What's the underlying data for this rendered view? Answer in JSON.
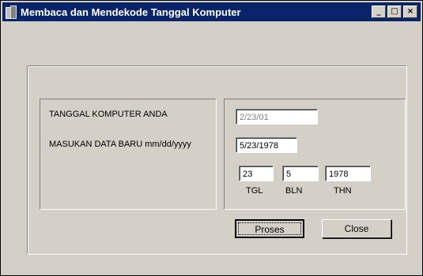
{
  "window": {
    "title": "Membaca dan Mendekode Tanggal Komputer",
    "buttons": {
      "minimize": "_",
      "maximize": "□",
      "close": "×"
    }
  },
  "form": {
    "label_computer_date": "TANGGAL  KOMPUTER ANDA",
    "label_new_data": "MASUKAN DATA BARU mm/dd/yyyy",
    "computer_date_value": "2/23/01",
    "new_date_value": "5/23/1978",
    "day_value": "23",
    "month_value": "5",
    "year_value": "1978",
    "day_label": "TGL",
    "month_label": "BLN",
    "year_label": "THN"
  },
  "actions": {
    "process_label": "Proses",
    "close_label": "Close"
  }
}
